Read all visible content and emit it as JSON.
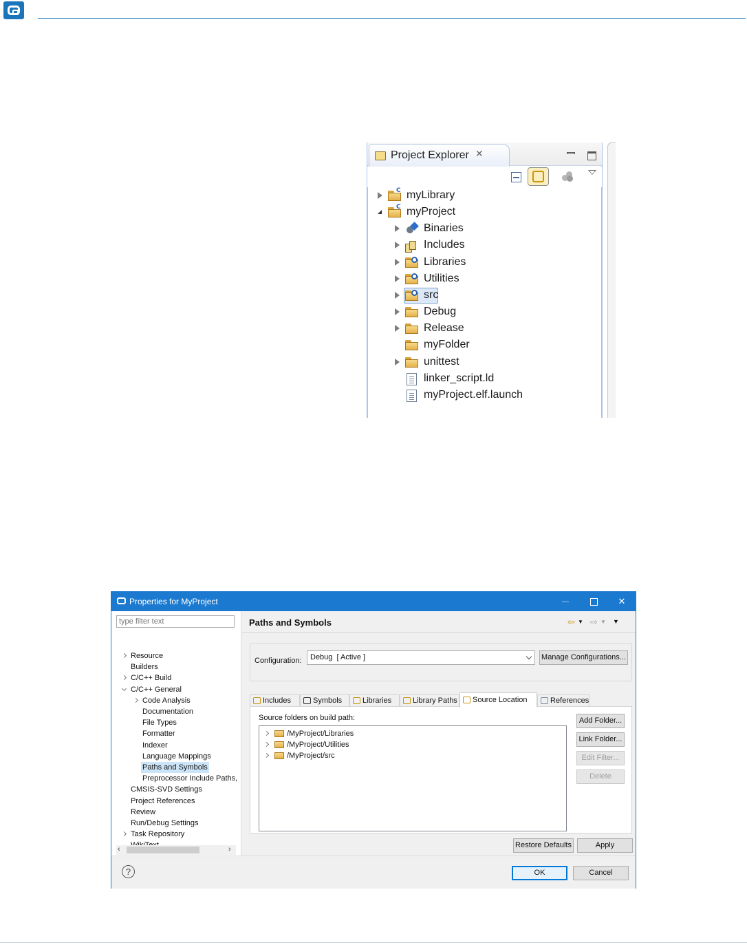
{
  "explorer": {
    "tab_title": "Project Explorer",
    "items": [
      {
        "label": "myLibrary",
        "twisty": "collapsed",
        "icon": "c-project-folder-icon"
      },
      {
        "label": "myProject",
        "twisty": "expanded",
        "icon": "c-project-folder-icon"
      },
      {
        "label": "Binaries",
        "twisty": "collapsed",
        "icon": "binaries-icon"
      },
      {
        "label": "Includes",
        "twisty": "collapsed",
        "icon": "includes-icon"
      },
      {
        "label": "Libraries",
        "twisty": "collapsed",
        "icon": "source-folder-icon"
      },
      {
        "label": "Utilities",
        "twisty": "collapsed",
        "icon": "source-folder-icon"
      },
      {
        "label": "src",
        "twisty": "collapsed",
        "icon": "source-folder-icon",
        "selected": true
      },
      {
        "label": "Debug",
        "twisty": "collapsed",
        "icon": "folder-icon"
      },
      {
        "label": "Release",
        "twisty": "collapsed",
        "icon": "folder-icon"
      },
      {
        "label": "myFolder",
        "twisty": "none",
        "icon": "folder-icon"
      },
      {
        "label": "unittest",
        "twisty": "collapsed",
        "icon": "folder-icon"
      },
      {
        "label": "linker_script.ld",
        "twisty": "none",
        "icon": "file-icon"
      },
      {
        "label": "myProject.elf.launch",
        "twisty": "none",
        "icon": "file-icon"
      }
    ]
  },
  "dialog": {
    "title": "Properties for MyProject",
    "filter_placeholder": "type filter text",
    "nav": [
      {
        "label": "Resource",
        "twisty": "collapsed"
      },
      {
        "label": "Builders",
        "twisty": "none"
      },
      {
        "label": "C/C++ Build",
        "twisty": "collapsed"
      },
      {
        "label": "C/C++ General",
        "twisty": "expanded"
      },
      {
        "label": "Code Analysis",
        "twisty": "collapsed"
      },
      {
        "label": "Documentation",
        "twisty": "none"
      },
      {
        "label": "File Types",
        "twisty": "none"
      },
      {
        "label": "Formatter",
        "twisty": "none"
      },
      {
        "label": "Indexer",
        "twisty": "none"
      },
      {
        "label": "Language Mappings",
        "twisty": "none"
      },
      {
        "label": "Paths and Symbols",
        "twisty": "none",
        "selected": true
      },
      {
        "label": "Preprocessor Include Paths,",
        "twisty": "none"
      },
      {
        "label": "CMSIS-SVD Settings",
        "twisty": "none"
      },
      {
        "label": "Project References",
        "twisty": "none"
      },
      {
        "label": "Review",
        "twisty": "none"
      },
      {
        "label": "Run/Debug Settings",
        "twisty": "none"
      },
      {
        "label": "Task Repository",
        "twisty": "collapsed"
      },
      {
        "label": "WikiText",
        "twisty": "none"
      }
    ],
    "page_title": "Paths and Symbols",
    "configuration_label": "Configuration:",
    "configuration_value": "Debug  [ Active ]",
    "manage_configurations": "Manage Configurations...",
    "tabs": [
      {
        "label": "Includes",
        "active": false
      },
      {
        "label": "Symbols",
        "active": false
      },
      {
        "label": "Libraries",
        "active": false
      },
      {
        "label": "Library Paths",
        "active": false
      },
      {
        "label": "Source Location",
        "active": true
      },
      {
        "label": "References",
        "active": false
      }
    ],
    "source_folders_label": "Source folders on build path:",
    "source_folders": [
      "/MyProject/Libraries",
      "/MyProject/Utilities",
      "/MyProject/src"
    ],
    "side_buttons": [
      {
        "label": "Add Folder...",
        "enabled": true
      },
      {
        "label": "Link Folder...",
        "enabled": true
      },
      {
        "label": "Edit Filter...",
        "enabled": false
      },
      {
        "label": "Delete",
        "enabled": false
      }
    ],
    "restore_defaults": "Restore Defaults",
    "apply": "Apply",
    "ok": "OK",
    "cancel": "Cancel",
    "help_glyph": "?"
  }
}
